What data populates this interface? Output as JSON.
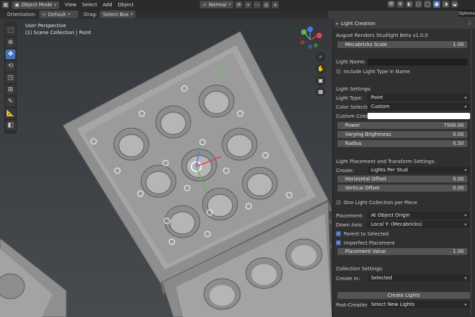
{
  "topbar": {
    "mode": "Object Mode",
    "menus": [
      "View",
      "Select",
      "Add",
      "Object"
    ],
    "transform": "Normal",
    "options": "Options"
  },
  "header2": {
    "orientation_label": "Orientation:",
    "orientation_value": "Default",
    "drag_label": "Drag:",
    "drag_value": "Select Box"
  },
  "viewport": {
    "line1": "User Perspective",
    "line2": "(1) Scene Collection | Point"
  },
  "panel": {
    "title": "Light Creation",
    "addon_title": "August Renders Studlight Beta v1.0.0",
    "scale_label": "Mecabricks Scale",
    "scale_value": "1.00",
    "light_name_label": "Light Name:",
    "include_type_label": "Include Light Type in Name",
    "light_settings_label": "Light Settings:",
    "light_type_label": "Light Type:",
    "light_type_value": "Point",
    "color_sel_label": "Color Selection:",
    "color_sel_value": "Custom",
    "custom_color_label": "Custom Color:",
    "power_label": "Power",
    "power_value": "7500.00",
    "varying_label": "Varying Brightness",
    "varying_value": "0.00",
    "radius_label": "Radius",
    "radius_value": "0.50",
    "placement_settings_label": "Light Placement and Transform Settings:",
    "create_label": "Create:",
    "create_value": "Lights Per Stud",
    "h_offset_label": "Horizontal Offset",
    "h_offset_value": "0.00",
    "v_offset_label": "Vertical Offset",
    "v_offset_value": "0.00",
    "one_collection_label": "One Light Collection per Piece",
    "placement_label": "Placement:",
    "placement_value": "At Object Origin",
    "down_axis_label": "Down Axis:",
    "down_axis_value": "Local Y- (Mecabricks)",
    "parent_label": "Parent to Selected",
    "imperfect_label": "Imperfect Placement",
    "placement_val_label": "Placement Value",
    "placement_val_value": "1.00",
    "collection_settings_label": "Collection Settings:",
    "create_in_label": "Create in:",
    "create_in_value": "Selected",
    "create_lights_button": "Create Lights",
    "post_creation_label": "Post-Creation:",
    "post_creation_value": "Select New Lights"
  },
  "colors": {
    "accent": "#4772b3",
    "custom_color": "#ffffff"
  }
}
